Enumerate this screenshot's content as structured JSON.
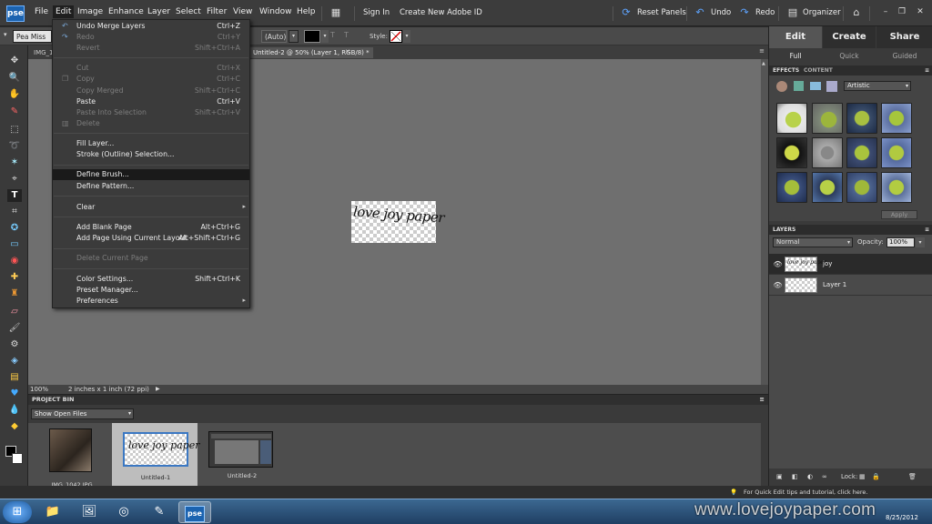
{
  "app": {
    "logo": "pse"
  },
  "menubar": {
    "items": [
      "File",
      "Edit",
      "Image",
      "Enhance",
      "Layer",
      "Select",
      "Filter",
      "View",
      "Window",
      "Help"
    ],
    "sign_in": "Sign In",
    "create_id": "Create New Adobe ID",
    "reset_panels": "Reset Panels",
    "undo": "Undo",
    "redo": "Redo",
    "organizer": "Organizer"
  },
  "optionsbar": {
    "font": "Pea Miss M...",
    "leading": "(Auto)",
    "style_label": "Style:"
  },
  "doctabs": {
    "tab1": "IMG_1",
    "tab2": "Untitled-2 @ 50% (Layer 1, RGB/8) *"
  },
  "edit_menu": {
    "items": [
      {
        "label": "Undo Merge Layers",
        "shortcut": "Ctrl+Z",
        "disabled": false
      },
      {
        "label": "Redo",
        "shortcut": "Ctrl+Y",
        "disabled": true
      },
      {
        "label": "Revert",
        "shortcut": "Shift+Ctrl+A",
        "disabled": true
      },
      {
        "label": "Cut",
        "shortcut": "Ctrl+X",
        "disabled": true
      },
      {
        "label": "Copy",
        "shortcut": "Ctrl+C",
        "disabled": true
      },
      {
        "label": "Copy Merged",
        "shortcut": "Shift+Ctrl+C",
        "disabled": true
      },
      {
        "label": "Paste",
        "shortcut": "Ctrl+V",
        "disabled": false
      },
      {
        "label": "Paste Into Selection",
        "shortcut": "Shift+Ctrl+V",
        "disabled": true
      },
      {
        "label": "Delete",
        "shortcut": "",
        "disabled": true
      },
      {
        "label": "Fill Layer...",
        "shortcut": "",
        "disabled": false
      },
      {
        "label": "Stroke (Outline) Selection...",
        "shortcut": "",
        "disabled": false
      },
      {
        "label": "Define Brush...",
        "shortcut": "",
        "disabled": false,
        "highlighted": true
      },
      {
        "label": "Define Pattern...",
        "shortcut": "",
        "disabled": false
      },
      {
        "label": "Clear",
        "shortcut": "",
        "disabled": false,
        "submenu": true
      },
      {
        "label": "Add Blank Page",
        "shortcut": "Alt+Ctrl+G",
        "disabled": false
      },
      {
        "label": "Add Page Using Current Layout",
        "shortcut": "Alt+Shift+Ctrl+G",
        "disabled": false
      },
      {
        "label": "Delete Current Page",
        "shortcut": "",
        "disabled": true
      },
      {
        "label": "Color Settings...",
        "shortcut": "Shift+Ctrl+K",
        "disabled": false
      },
      {
        "label": "Preset Manager...",
        "shortcut": "",
        "disabled": false
      },
      {
        "label": "Preferences",
        "shortcut": "",
        "disabled": false,
        "submenu": true
      }
    ]
  },
  "canvas": {
    "art_text": "love joy paper"
  },
  "statusbar": {
    "zoom": "100%",
    "doc_size": "2 inches x 1 inch (72 ppi)"
  },
  "project_bin": {
    "title": "PROJECT BIN",
    "filter": "Show Open Files",
    "thumbnails": [
      {
        "label": "IMG_1042.JPG"
      },
      {
        "label": "Untitled-1",
        "selected": true
      },
      {
        "label": "Untitled-2"
      }
    ]
  },
  "right_panel": {
    "tabs": [
      "Edit",
      "Create",
      "Share"
    ],
    "subtabs": [
      "Full",
      "Quick",
      "Guided"
    ],
    "effects_tabs": [
      "EFFECTS",
      "CONTENT"
    ],
    "effects_filter": "Artistic",
    "apply": "Apply",
    "layers_title": "LAYERS",
    "blend_mode": "Normal",
    "opacity_label": "Opacity:",
    "opacity_value": "100%",
    "layers": [
      {
        "name": "joy",
        "selected": true
      },
      {
        "name": "Layer 1",
        "selected": false
      }
    ],
    "lock_label": "Lock:"
  },
  "tip": "For Quick Edit tips and tutorial, click here.",
  "taskbar": {
    "watermark": "www.lovejoypaper.com",
    "date": "8/25/2012"
  }
}
